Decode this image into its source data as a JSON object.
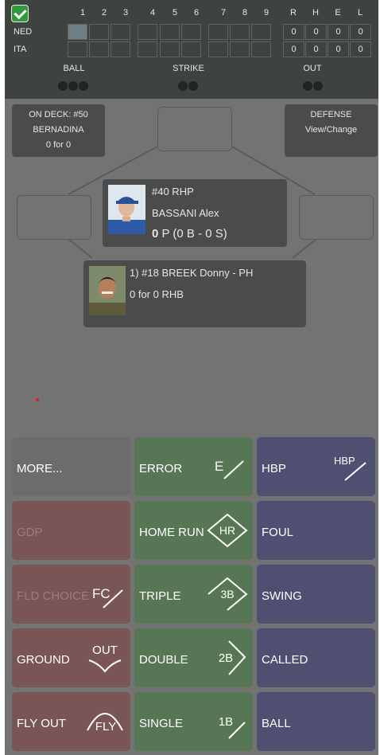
{
  "scoreboard": {
    "innings": [
      "1",
      "2",
      "3",
      "4",
      "5",
      "6",
      "7",
      "8",
      "9"
    ],
    "stat_headers": [
      "R",
      "H",
      "E",
      "L"
    ],
    "teams": [
      {
        "name": "NED",
        "stats": [
          "0",
          "0",
          "0",
          "0"
        ]
      },
      {
        "name": "ITA",
        "stats": [
          "0",
          "0",
          "0",
          "0"
        ]
      }
    ],
    "count": {
      "ball_label": "BALL",
      "balls": 3,
      "strike_label": "STRIKE",
      "strikes": 2,
      "out_label": "OUT",
      "outs": 2
    }
  },
  "on_deck": {
    "line1": "ON DECK: #50",
    "line2": "BERNADINA",
    "line3": "0 for 0"
  },
  "defense": {
    "line1": "DEFENSE",
    "line2": "View/Change"
  },
  "pitcher": {
    "number": "#40 RHP",
    "name": "BASSANI Alex",
    "count_bold": "0",
    "count_rest": "P (0 B - 0 S)"
  },
  "batter": {
    "line1": "1) #18 BREEK Donny - PH",
    "line2": "0 for 0 RHB"
  },
  "buttons": {
    "more": "MORE...",
    "error": "ERROR",
    "error_sym": "E",
    "hbp": "HBP",
    "hbp_sym": "HBP",
    "gdp": "GDP",
    "home_run": "HOME RUN",
    "home_run_sym": "HR",
    "foul": "FOUL",
    "fld_choice": "FLD CHOICE",
    "fld_choice_sym": "FC",
    "triple": "TRIPLE",
    "triple_sym": "3B",
    "swing": "SWING",
    "ground": "GROUND",
    "ground_sym": "OUT",
    "double": "DOUBLE",
    "double_sym": "2B",
    "called": "CALLED",
    "fly_out": "FLY OUT",
    "fly_out_sym": "FLY",
    "single": "SINGLE",
    "single_sym": "1B",
    "ball": "BALL"
  },
  "colors": {
    "scoreboard_bg": "#3e4340",
    "field_bg": "#737373",
    "red_btn": "#7a5555",
    "green_btn": "#567656",
    "blue_btn": "#4f4f72",
    "gray_btn": "#6c6c6c"
  }
}
